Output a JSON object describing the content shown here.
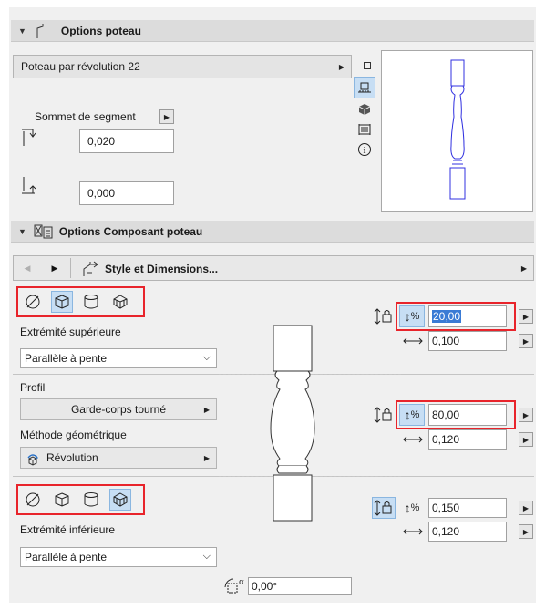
{
  "column_options": {
    "title": "Options poteau",
    "column_type": "Poteau par révolution 22",
    "segment_top_label": "Sommet de segment",
    "top_value": "0,020",
    "bottom_value": "0,000"
  },
  "component_options": {
    "title": "Options Composant poteau",
    "page_label": "Style et Dimensions...",
    "top_end_label": "Extrémité supérieure",
    "top_end_value": "Parallèle à pente",
    "profile_label": "Profil",
    "profile_value": "Garde-corps tourné",
    "geometry_method_label": "Méthode géométrique",
    "geometry_method_value": "Révolution",
    "bottom_end_label": "Extrémité inférieure",
    "bottom_end_value": "Parallèle à pente",
    "top_height_value": "20,00",
    "top_width_value": "0,100",
    "mid_height_value": "80,00",
    "mid_width_value": "0,120",
    "bottom_height_value": "0,150",
    "bottom_width_value": "0,120",
    "angle_value": "0,00°",
    "percent_symbol": "%"
  },
  "colors": {
    "highlight_red": "#e8242b",
    "selected_blue": "#c7def4",
    "preview_outline": "#3030e0"
  }
}
